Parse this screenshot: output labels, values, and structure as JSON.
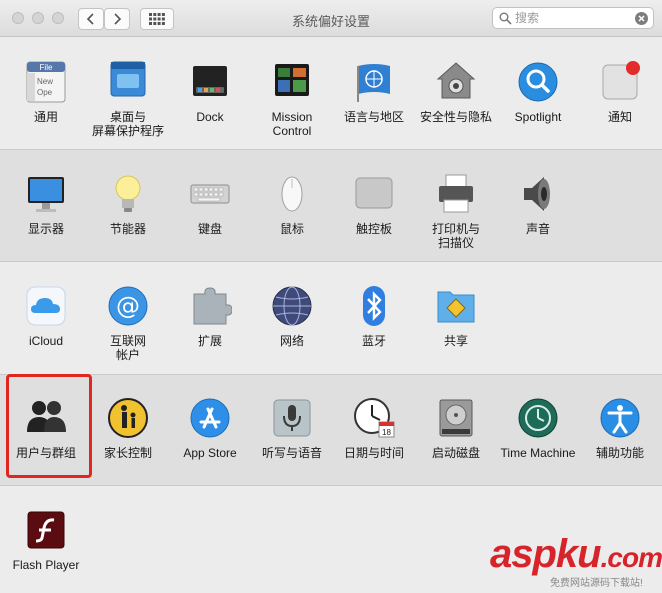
{
  "window": {
    "title": "系统偏好设置",
    "search_placeholder": "搜索"
  },
  "panes": {
    "general": "通用",
    "desktop": "桌面与\n屏幕保护程序",
    "dock": "Dock",
    "mission": "Mission\nControl",
    "language": "语言与地区",
    "security": "安全性与隐私",
    "spotlight": "Spotlight",
    "notifications": "通知",
    "displays": "显示器",
    "energy": "节能器",
    "keyboard": "键盘",
    "mouse": "鼠标",
    "trackpad": "触控板",
    "printers": "打印机与\n扫描仪",
    "sound": "声音",
    "icloud": "iCloud",
    "internet": "互联网\n帐户",
    "extensions": "扩展",
    "network": "网络",
    "bluetooth": "蓝牙",
    "sharing": "共享",
    "users": "用户与群组",
    "parental": "家长控制",
    "appstore": "App Store",
    "dictation": "听写与语音",
    "datetime": "日期与时间",
    "startup": "启动磁盘",
    "timemachine": "Time Machine",
    "accessibility": "辅助功能",
    "flash": "Flash Player"
  },
  "icon_text": {
    "general_file": "File",
    "general_new": "New",
    "general_ope": "Ope",
    "calendar_day": "18"
  },
  "watermark": {
    "brand": "aspku",
    "tld": ".com",
    "tagline": "免费网站源码下载站!"
  },
  "colors": {
    "highlight": "#e0261f",
    "watermark": "#d7242a"
  }
}
